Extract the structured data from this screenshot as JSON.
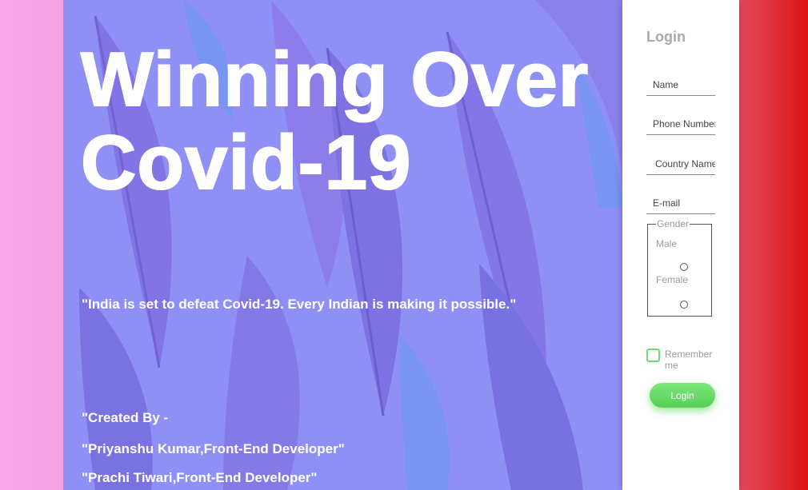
{
  "hero": {
    "title": "Winning Over Covid-19",
    "quote": "\"India is set to defeat Covid-19. Every Indian is making it possible.\"",
    "credits_heading": "\"Created By -",
    "credit_1": "\"Priyanshu Kumar,Front-End Developer\"",
    "credit_2": "\"Prachi Tiwari,Front-End Developer\""
  },
  "login_form": {
    "title": "Login",
    "name_placeholder": "Name",
    "phone_placeholder": "Phone Number",
    "country_placeholder": "Country Name",
    "email_placeholder": "E-mail",
    "gender_legend": "Gender",
    "gender_options": [
      "Male",
      "Female"
    ],
    "remember_label": "Remember me",
    "submit_label": "Login"
  },
  "colors": {
    "hero_bg": "#8f90f6",
    "panel_bg": "#ffffff",
    "button_green": "#5ed65e",
    "checkbox_border": "#6fdc6f",
    "left_edge_pink": "#f7a4ec",
    "right_edge_red": "#dc1414"
  }
}
